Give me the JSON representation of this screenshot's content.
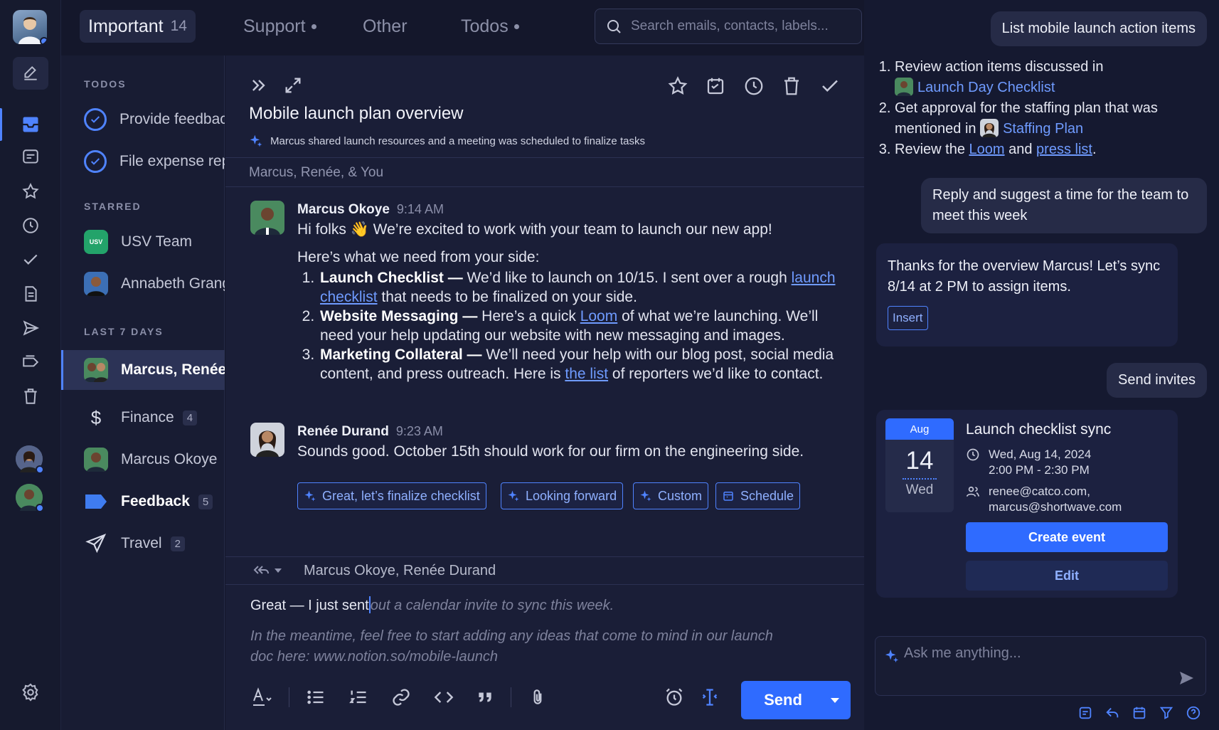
{
  "tabs": [
    {
      "label": "Important",
      "count": "14"
    },
    {
      "label": "Support"
    },
    {
      "label": "Other"
    },
    {
      "label": "Todos"
    }
  ],
  "search": {
    "placeholder": "Search emails, contacts, labels..."
  },
  "sidebar": {
    "todos_label": "TODOS",
    "todos": [
      "Provide feedback",
      "File expense report"
    ],
    "starred_label": "STARRED",
    "starred": [
      "USV Team",
      "Annabeth Granger"
    ],
    "usv_badge": "USV",
    "last7_label": "LAST 7 DAYS",
    "last7": [
      {
        "label": "Marcus, Renée"
      },
      {
        "label": "Finance",
        "count": "4"
      },
      {
        "label": "Marcus Okoye"
      },
      {
        "label": "Feedback",
        "count": "5"
      },
      {
        "label": "Travel",
        "count": "2"
      }
    ]
  },
  "email": {
    "title": "Mobile launch plan overview",
    "summary": "Marcus shared launch resources and a meeting was scheduled to finalize tasks",
    "participants": "Marcus, Renée, & You",
    "messages": [
      {
        "sender": "Marcus Okoye",
        "time": "9:14 AM",
        "greeting": "Hi folks 👋 We’re excited to work with your team to launch our new app!",
        "intro": "Here’s what we need from your side:",
        "items": [
          {
            "title": "Launch Checklist —",
            "pre": " We’d like to launch on 10/15. I sent over a rough ",
            "link": "launch checklist",
            "post": " that needs to be finalized on your side."
          },
          {
            "title": "Website Messaging —",
            "pre": " Here’s a quick ",
            "link": "Loom",
            "post": " of what we’re launching. We’ll need your help updating our website with new messaging and images."
          },
          {
            "title": "Marketing Collateral —",
            "pre": " We’ll need your help with our blog post, social media content, and press outreach. Here is ",
            "link": "the list",
            "post": " of reporters we’d like to contact."
          }
        ]
      },
      {
        "sender": "Renée Durand",
        "time": "9:23 AM",
        "body": "Sounds good. October 15th should work for our firm on the engineering side."
      }
    ],
    "quick_replies": [
      "Great, let’s finalize checklist",
      "Looking forward",
      "Custom",
      "Schedule"
    ]
  },
  "compose": {
    "recipients": "Marcus Okoye, Renée Durand",
    "typed": "Great — I just sent",
    "ghost1": "out a calendar invite to sync this week.",
    "ghost2": "In the meantime, feel free to start adding any ideas that come to mind in our launch doc here: www.notion.so/mobile-launch",
    "send_label": "Send"
  },
  "assistant": {
    "prompt1": "List mobile launch action items",
    "list": [
      {
        "pre": "Review action items discussed in",
        "link": "Launch Day Checklist"
      },
      {
        "pre": "Get approval for the staffing plan that was mentioned in",
        "link": "Staffing Plan"
      },
      {
        "pre": "Review the",
        "link1": "Loom",
        "mid": "and",
        "link2": "press list",
        "post": "."
      }
    ],
    "prompt2": "Reply and suggest a time for the team to meet this week",
    "reply": "Thanks for the overview Marcus! Let’s sync 8/14 at 2 PM to assign items.",
    "insert_label": "Insert",
    "prompt3": "Send invites",
    "event": {
      "month": "Aug",
      "day": "14",
      "weekday": "Wed",
      "title": "Launch checklist sync",
      "date": "Wed, Aug 14, 2024",
      "time": "2:00 PM - 2:30 PM",
      "guest1": "renee@catco.com,",
      "guest2": "marcus@shortwave.com",
      "create_label": "Create event",
      "edit_label": "Edit"
    },
    "ask_placeholder": "Ask me anything..."
  },
  "colors": {
    "accent": "#2f6bff",
    "link": "#6f9bff",
    "bg": "#14172b"
  }
}
